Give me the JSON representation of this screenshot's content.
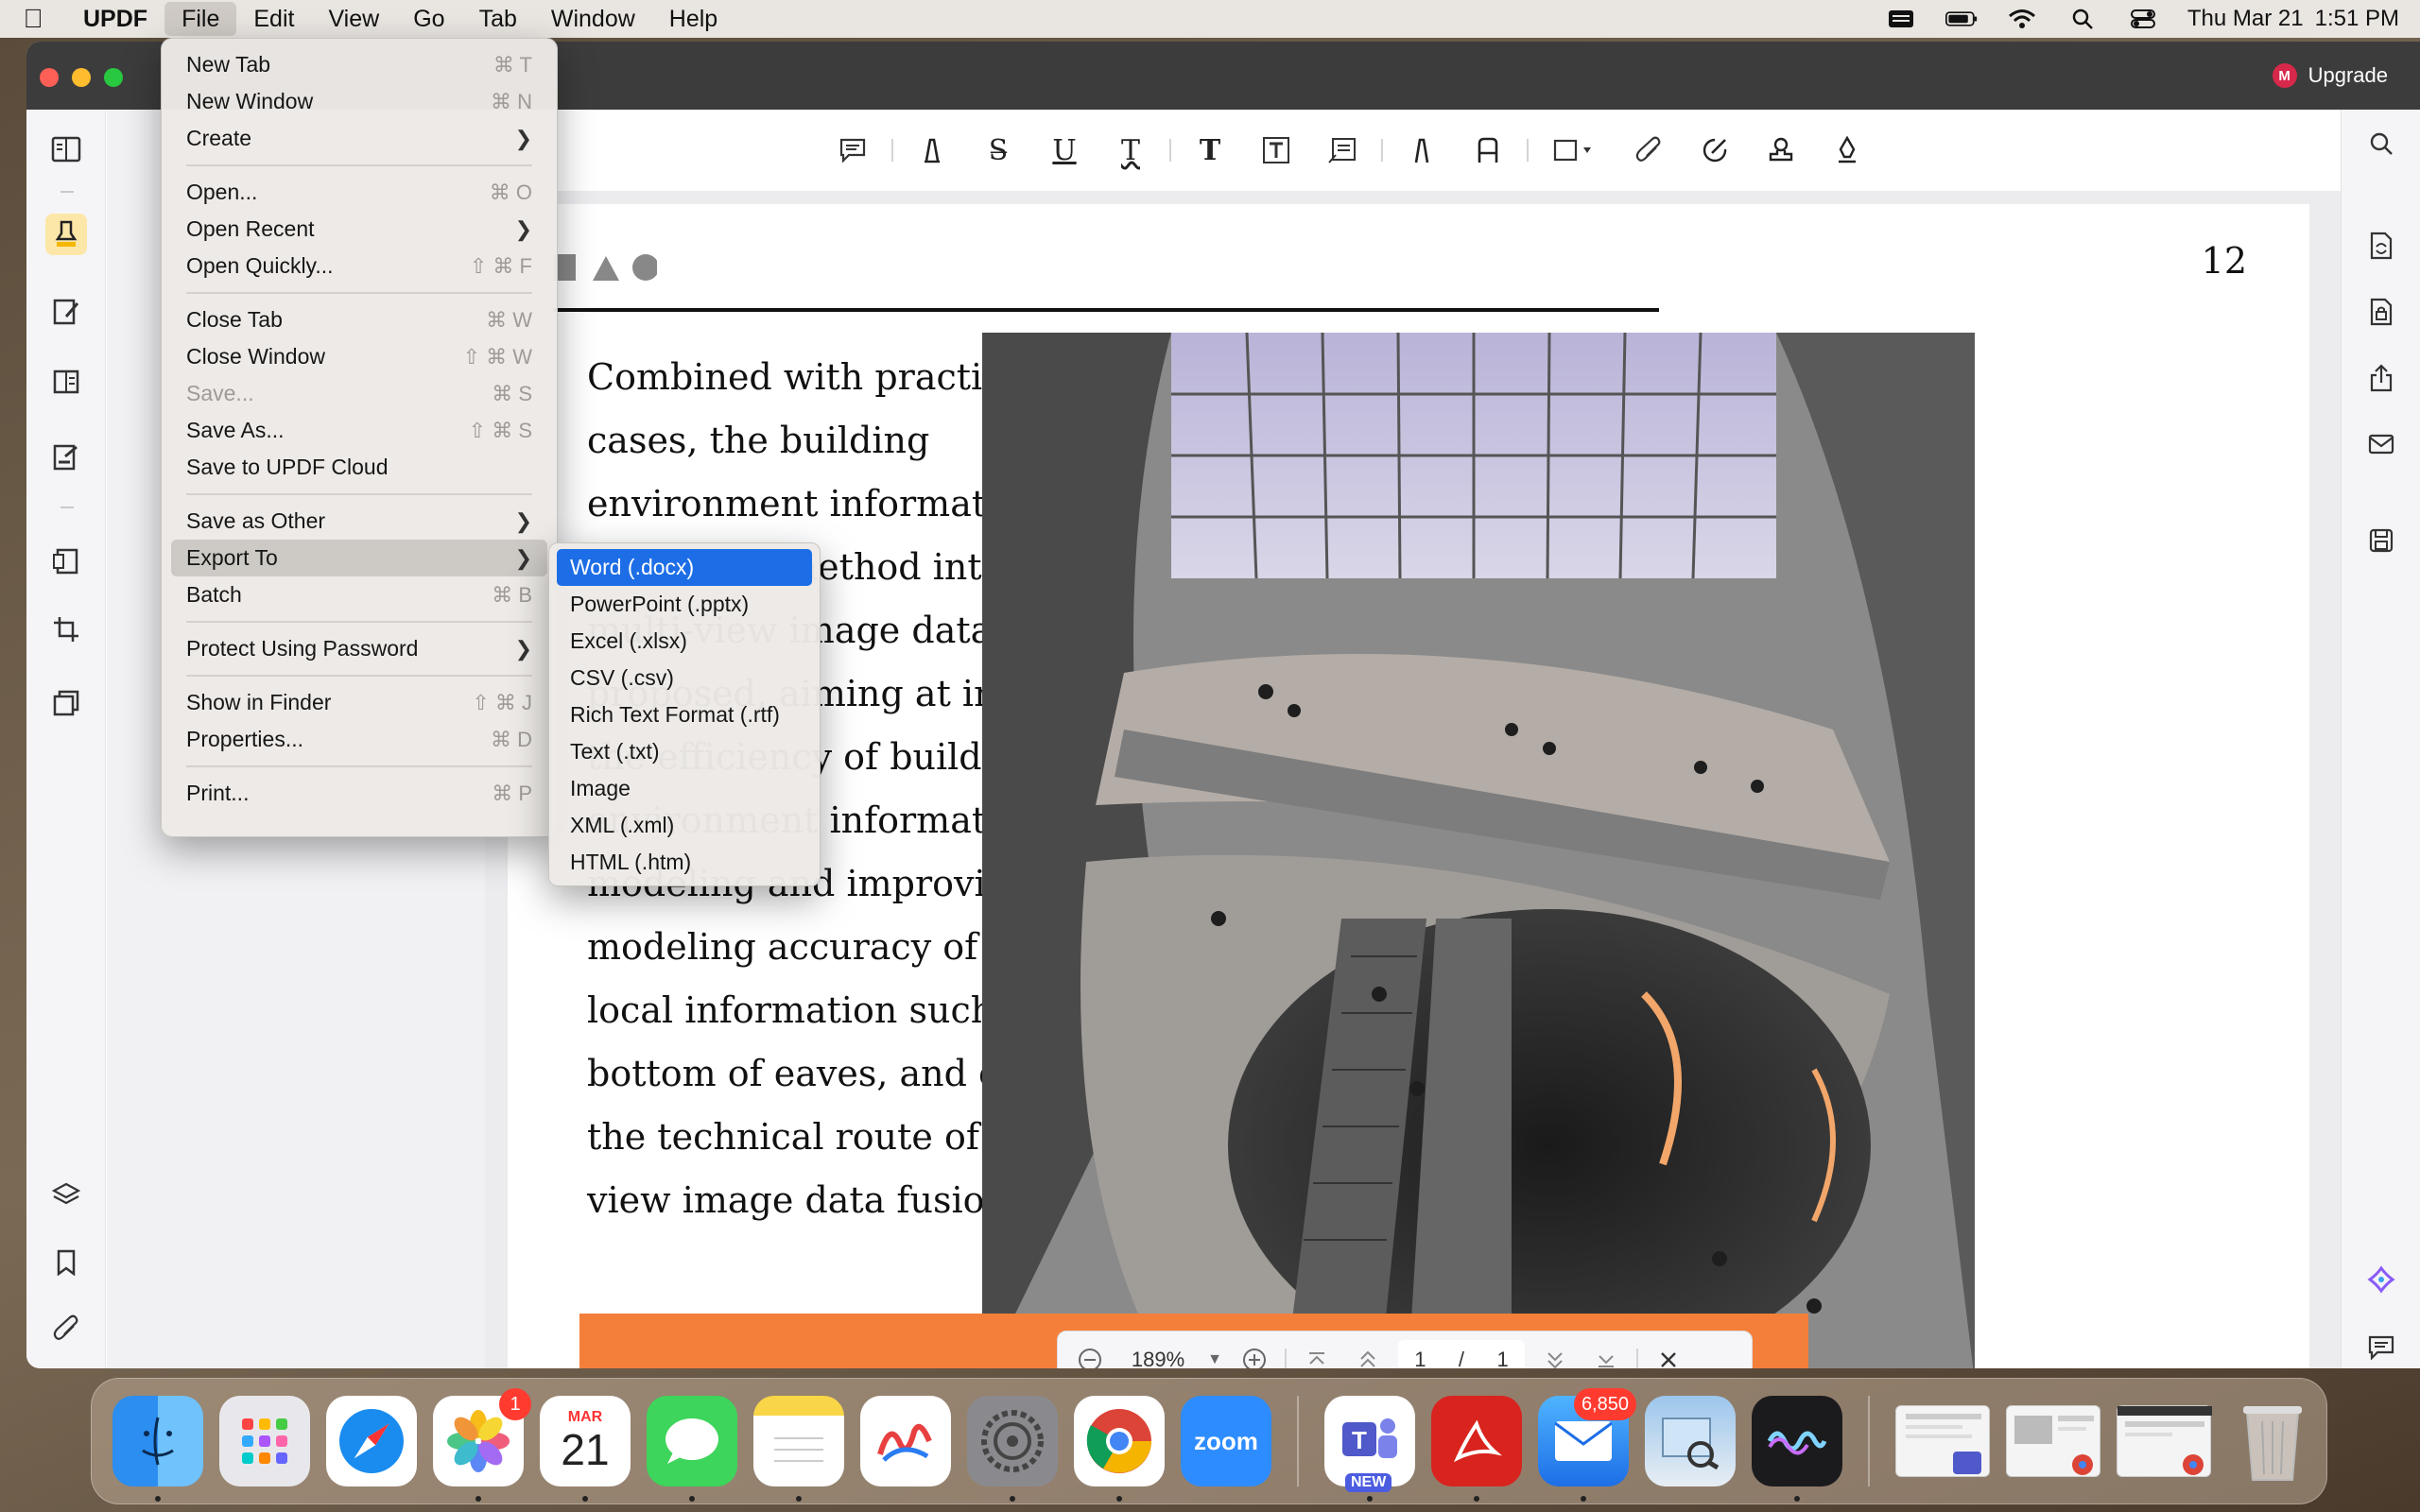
{
  "menubar": {
    "app_name": "UPDF",
    "items": [
      "File",
      "Edit",
      "View",
      "Go",
      "Tab",
      "Window",
      "Help"
    ],
    "date": "Thu Mar 21",
    "time": "1:51 PM"
  },
  "window": {
    "upgrade_label": "Upgrade",
    "avatar_letter": "M"
  },
  "file_menu": {
    "groups": [
      [
        {
          "label": "New Tab",
          "shortcut": "⌘ T"
        },
        {
          "label": "New Window",
          "shortcut": "⌘ N"
        },
        {
          "label": "Create",
          "submenu": true
        }
      ],
      [
        {
          "label": "Open...",
          "shortcut": "⌘ O"
        },
        {
          "label": "Open Recent",
          "submenu": true
        },
        {
          "label": "Open Quickly...",
          "shortcut": "⇧ ⌘ F"
        }
      ],
      [
        {
          "label": "Close Tab",
          "shortcut": "⌘ W"
        },
        {
          "label": "Close Window",
          "shortcut": "⇧ ⌘ W"
        },
        {
          "label": "Save...",
          "shortcut": "⌘ S",
          "disabled": true
        },
        {
          "label": "Save As...",
          "shortcut": "⇧ ⌘ S"
        },
        {
          "label": "Save to UPDF Cloud"
        }
      ],
      [
        {
          "label": "Save as Other",
          "submenu": true
        },
        {
          "label": "Export To",
          "submenu": true,
          "highlighted": true
        },
        {
          "label": "Batch",
          "shortcut": "⌘ B"
        }
      ],
      [
        {
          "label": "Protect Using Password",
          "submenu": true
        }
      ],
      [
        {
          "label": "Show in Finder",
          "shortcut": "⇧ ⌘ J"
        },
        {
          "label": "Properties...",
          "shortcut": "⌘ D"
        }
      ],
      [
        {
          "label": "Print...",
          "shortcut": "⌘ P"
        }
      ]
    ]
  },
  "export_submenu": {
    "items": [
      "Word (.docx)",
      "PowerPoint (.pptx)",
      "Excel (.xlsx)",
      "CSV (.csv)",
      "Rich Text Format (.rtf)",
      "Text (.txt)",
      "Image",
      "XML (.xml)",
      "HTML (.htm)"
    ],
    "selected_index": 0
  },
  "document": {
    "page_number": "12",
    "body_lines": [
      "Combined with practical",
      "cases, the building",
      "environment information",
      "extraction method integrating",
      "multi-view image data is",
      "proposed, aiming at improving",
      "the efficiency of building",
      "environment information",
      "modeling and improving the",
      "modeling accuracy of building",
      "local information such as the",
      "bottom of eaves, and exploring",
      "the technical route of multi-",
      "view image data fusion."
    ]
  },
  "zoom": {
    "value": "189%",
    "current_page": "1",
    "separator": "/",
    "total_pages": "1"
  },
  "dock": {
    "calendar_month": "MAR",
    "calendar_day": "21",
    "photos_badge": "1",
    "mail_badge": "6,850",
    "zoom_label": "zoom",
    "teams_new": "NEW"
  },
  "colors": {
    "accent": "#1d6ee6",
    "orange_bar": "#f47f3a",
    "menu_highlight": "#cdcac6"
  }
}
